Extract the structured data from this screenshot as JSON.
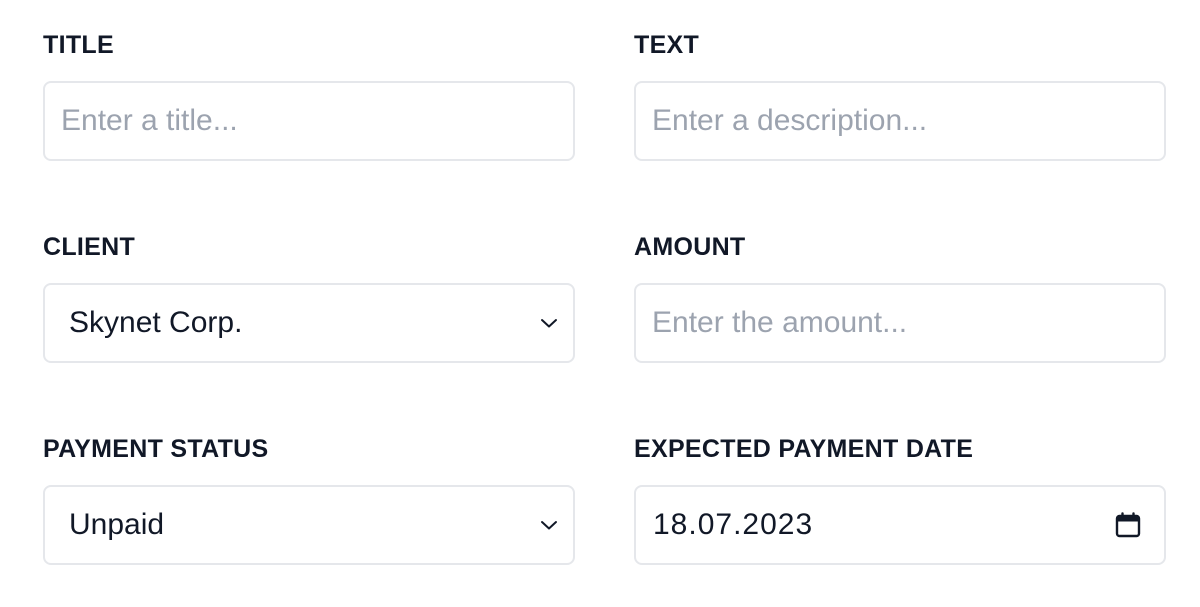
{
  "fields": {
    "title": {
      "label": "TITLE",
      "placeholder": "Enter a title..."
    },
    "text": {
      "label": "TEXT",
      "placeholder": "Enter a description..."
    },
    "client": {
      "label": "CLIENT",
      "value": "Skynet Corp."
    },
    "amount": {
      "label": "AMOUNT",
      "placeholder": "Enter the amount..."
    },
    "payment_status": {
      "label": "PAYMENT STATUS",
      "value": "Unpaid"
    },
    "expected_payment_date": {
      "label": "EXPECTED PAYMENT DATE",
      "value": "18.07.2023"
    }
  },
  "icons": {
    "select_arrow": "chevron-down-icon",
    "date_picker": "calendar-icon"
  },
  "colors": {
    "text": "#111827",
    "placeholder": "#9ca3af",
    "border": "#e5e7eb"
  }
}
